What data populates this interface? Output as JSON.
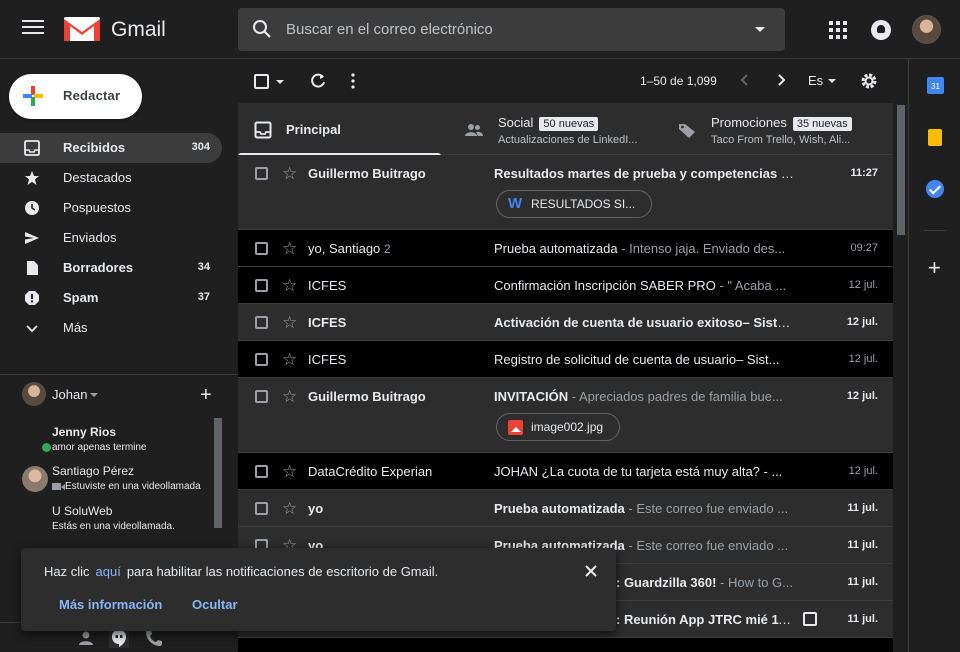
{
  "header": {
    "brand": "Gmail",
    "search_placeholder": "Buscar en el correo electrónico"
  },
  "compose": {
    "label": "Redactar"
  },
  "nav": [
    {
      "label": "Recibidos",
      "count": "304",
      "icon": "inbox-icon"
    },
    {
      "label": "Destacados",
      "count": "",
      "icon": "star-icon"
    },
    {
      "label": "Pospuestos",
      "count": "",
      "icon": "clock-icon"
    },
    {
      "label": "Enviados",
      "count": "",
      "icon": "send-icon"
    },
    {
      "label": "Borradores",
      "count": "34",
      "icon": "draft-icon"
    },
    {
      "label": "Spam",
      "count": "37",
      "icon": "spam-icon"
    },
    {
      "label": "Más",
      "count": "",
      "icon": "chevron-down-icon"
    }
  ],
  "hangouts": {
    "user": "Johan",
    "contacts": [
      {
        "name": "Jenny Rios",
        "status": "amor apenas termine"
      },
      {
        "name": "Santiago Pérez",
        "status": "Estuviste en una videollamada"
      },
      {
        "name": "U SoluWeb",
        "status": "Estás en una videollamada."
      }
    ]
  },
  "toolbar": {
    "range": "1–50 de 1,099",
    "lang": "Es"
  },
  "tabs": [
    {
      "title": "Principal",
      "badge": "",
      "sub": ""
    },
    {
      "title": "Social",
      "badge": "50 nuevas",
      "sub": "Actualizaciones de LinkedI..."
    },
    {
      "title": "Promociones",
      "badge": "35 nuevas",
      "sub": "Taco From Trello, Wish, Ali..."
    }
  ],
  "emails": [
    {
      "sender": "Guillermo Buitrago",
      "thread": "",
      "subject": "Resultados martes de prueba y competencias c...",
      "snippet": "",
      "date": "11:27",
      "attachment": "RESULTADOS SI...",
      "attach_icon": "word-doc-icon"
    },
    {
      "sender": "yo, Santiago",
      "thread": "2",
      "subject": "Prueba automatizada",
      "snippet": " - Intenso jaja. Enviado des...",
      "date": "09:27",
      "attachment": ""
    },
    {
      "sender": "ICFES",
      "thread": "",
      "subject": "Confirmación Inscripción SABER PRO",
      "snippet": " - \" Acaba ...",
      "date": "12 jul.",
      "attachment": ""
    },
    {
      "sender": "ICFES",
      "thread": "",
      "subject": "Activación de cuenta de usuario exitoso– Siste...",
      "snippet": "",
      "date": "12 jul.",
      "attachment": ""
    },
    {
      "sender": "ICFES",
      "thread": "",
      "subject": "Registro de solicitud de cuenta de usuario– Sist...",
      "snippet": "",
      "date": "12 jul.",
      "attachment": ""
    },
    {
      "sender": "Guillermo Buitrago",
      "thread": "",
      "subject": "INVITACIÓN",
      "snippet": " - Apreciados padres de familia bue...",
      "date": "12 jul.",
      "attachment": "image002.jpg",
      "attach_icon": "image-icon"
    },
    {
      "sender": "DataCrédito Experian",
      "thread": "",
      "subject": "JOHAN ¿La cuota de tu tarjeta está muy alta? - ...",
      "snippet": "",
      "date": "12 jul.",
      "attachment": ""
    },
    {
      "sender": "yo",
      "thread": "",
      "subject": "Prueba automatizada",
      "snippet": " - Este correo fue enviado ...",
      "date": "11 jul.",
      "attachment": ""
    },
    {
      "sender": "yo",
      "thread": "",
      "subject": "Prueba automatizada",
      "snippet": " - Este correo fue enviado ...",
      "date": "11 jul.",
      "attachment": ""
    },
    {
      "sender": "",
      "thread": "",
      "subject": ": Guardzilla 360!",
      "snippet": " - How to G...",
      "date": "11 jul.",
      "attachment": ""
    },
    {
      "sender": "",
      "thread": "",
      "subject": ": Reunión App JTRC mié 11...",
      "snippet": "",
      "date": "11 jul.",
      "attachment": ""
    }
  ],
  "toast": {
    "text_before": "Haz clic",
    "link": "aquí",
    "text_after": "para habilitar las notificaciones de escritorio de Gmail.",
    "more": "Más información",
    "hide": "Ocultar"
  }
}
